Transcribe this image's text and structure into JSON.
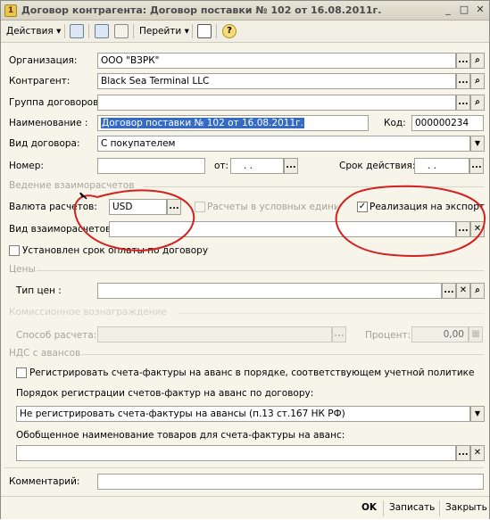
{
  "window": {
    "title": "Договор контрагента: Договор поставки № 102 от 16.08.2011г.",
    "minimize": "_",
    "maximize": "□",
    "close": "✕"
  },
  "toolbar": {
    "actions_label": "Действия",
    "goto_label": "Перейти",
    "help_glyph": "?"
  },
  "fields": {
    "org_label": "Организация:",
    "org_value": "ООО \"ВЗРК\"",
    "contractor_label": "Контрагент:",
    "contractor_value": "Black Sea Terminal LLC",
    "group_label": "Группа договоров:",
    "group_value": "",
    "name_label": "Наименование :",
    "name_value": "Договор поставки № 102 от 16.08.2011г.",
    "code_label": "Код:",
    "code_value": "000000234",
    "type_label": "Вид договора:",
    "type_value": "С покупателем",
    "number_label": "Номер:",
    "number_value": "",
    "from_label": "от:",
    "from_value": ". .",
    "validity_label": "Срок действия:",
    "validity_value": ". ."
  },
  "settlement": {
    "section": "Ведение взаиморасчетов",
    "currency_label": "Валюта расчетов:",
    "currency_value": "USD",
    "conditional_units": "Расчеты в условных единицах",
    "export_label": "Реализация на экспорт",
    "kind_label": "Вид взаиморасчетов:",
    "kind_value": "",
    "payment_term_label": "Установлен срок оплаты по договору"
  },
  "prices": {
    "section": "Цены",
    "price_type_label": "Тип цен :",
    "price_type_value": ""
  },
  "commission": {
    "section": "Комиссионное вознаграждение",
    "method_label": "Способ расчета:",
    "method_value": "",
    "percent_label": "Процент:",
    "percent_value": "0,00"
  },
  "vat": {
    "section": "НДС с авансов",
    "register_label": "Регистрировать счета-фактуры на аванс в порядке, соответствующем учетной политике",
    "order_label": "Порядок регистрации счетов-фактур на аванс по договору:",
    "order_value": "Не регистрировать счета-фактуры на авансы (п.13 ст.167 НК РФ)",
    "generic_label": "Обобщенное наименование товаров для счета-фактуры на аванс:",
    "generic_value": ""
  },
  "comment": {
    "label": "Комментарий:",
    "value": ""
  },
  "footer": {
    "ok": "OK",
    "save": "Записать",
    "close": "Закрыть"
  },
  "colors": {
    "annotation": "#d42020",
    "selection": "#356bc5"
  }
}
